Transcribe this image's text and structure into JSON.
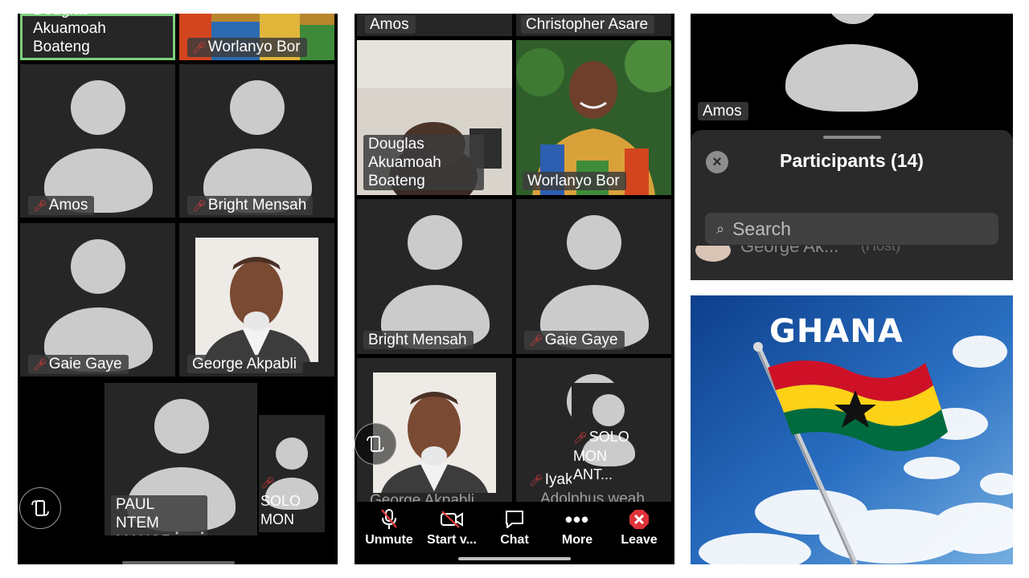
{
  "panel1": {
    "tiles": {
      "douglas": "Douglas Akuamoah Boateng",
      "worlanyo": "Worlanyo Bor",
      "amos": "Amos",
      "bright": "Bright Mensah",
      "gaie": "Gaie Gaye",
      "george": "George Akpabli",
      "paul": "PAUL NTEM MANOR",
      "solo": "SOLO MON ANT..."
    }
  },
  "panel2": {
    "tiles": {
      "amos": "Amos",
      "christopher": "Christopher Asare",
      "douglas": "Douglas Akuamoah Boateng",
      "worlanyo": "Worlanyo Bor",
      "bright": "Bright Mensah",
      "gaie": "Gaie Gaye",
      "george": "George Akpabli",
      "iyaka": "Iyaka",
      "adolphus": "Adolphus weah",
      "solo": "SOLO MON ANT..."
    },
    "toolbar": {
      "unmute": "Unmute",
      "start_video": "Start v...",
      "chat": "Chat",
      "more": "More",
      "leave": "Leave"
    }
  },
  "panel3": {
    "tile_name": "Amos",
    "title": "Participants (14)",
    "search_placeholder": "Search",
    "peek_row": {
      "name": "George Ak...",
      "role": "(Host)"
    }
  },
  "panel4": {
    "caption": "GHANA"
  },
  "colors": {
    "tile_bg": "#262626",
    "avatar": "#cbcbcb",
    "muted_mic": "#e23b3b",
    "leave_red": "#e0333a",
    "active_speaker_border": "#7bd07b",
    "flag_red": "#ce1126",
    "flag_gold": "#fcd116",
    "flag_green": "#006b3f"
  },
  "icons": [
    "mic-muted-icon",
    "rotate-screen-icon",
    "microphone-off-icon",
    "video-off-icon",
    "chat-bubble-icon",
    "more-dots-icon",
    "leave-icon",
    "close-icon",
    "search-icon"
  ]
}
